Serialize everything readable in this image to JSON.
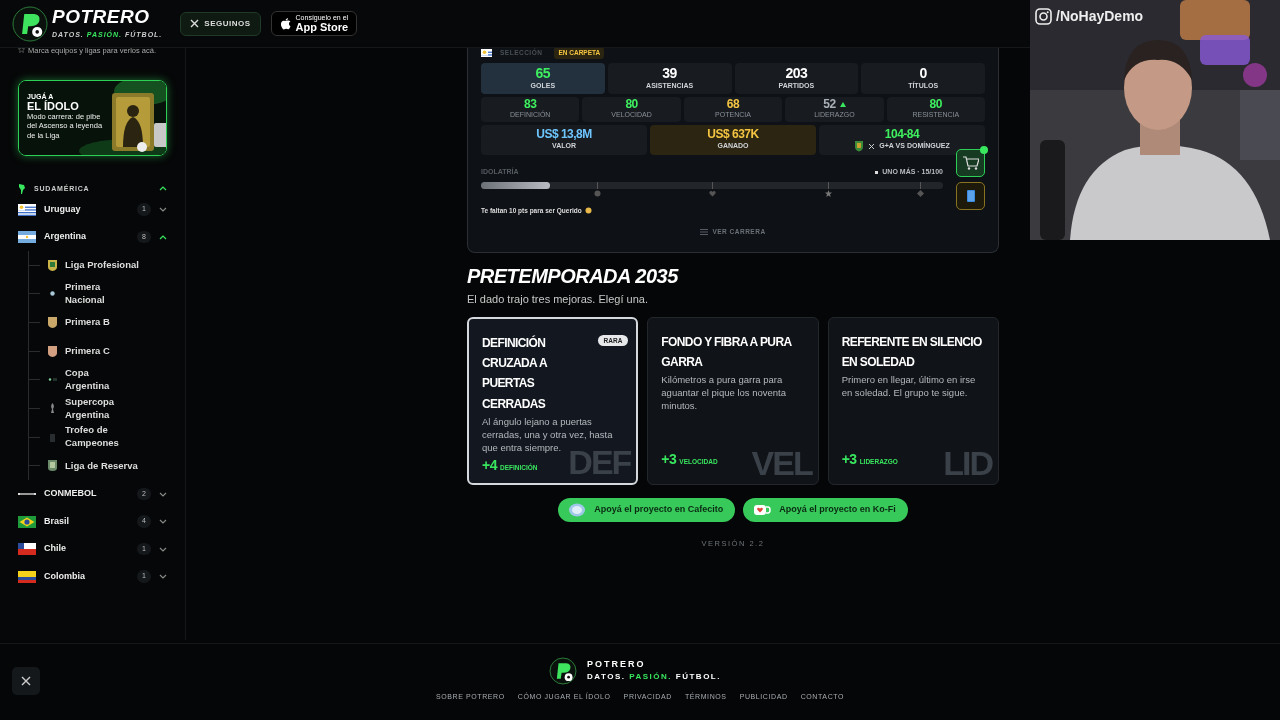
{
  "header": {
    "brand": "POTRERO",
    "tagline": [
      {
        "text": "DATOS.",
        "accent": false
      },
      {
        "text": "PASIÓN.",
        "accent": true
      },
      {
        "text": "FÚTBOL.",
        "accent": false
      }
    ],
    "follow_button": "SEGUINOS",
    "store_button": {
      "caption": "Consíguelo en el",
      "label": "App Store"
    }
  },
  "sidebar": {
    "hint": "Marca equipos y ligas para verlos acá.",
    "promo": {
      "kicker": "JUGÁ A",
      "title": "EL ÍDOLO",
      "text": "Modo carrera: de pibe del Ascenso a leyenda de la Liga"
    },
    "region": {
      "label": "SUDAMÉRICA",
      "expanded": true
    },
    "items": [
      {
        "name": "Uruguay",
        "count": "1",
        "expanded": false
      },
      {
        "name": "Argentina",
        "count": "8",
        "expanded": true,
        "children": [
          {
            "name": "Liga Profesional"
          },
          {
            "name": "Primera Nacional"
          },
          {
            "name": "Primera B"
          },
          {
            "name": "Primera C"
          },
          {
            "name": "Copa Argentina"
          },
          {
            "name": "Supercopa Argentina"
          },
          {
            "name": "Trofeo de Campeones"
          },
          {
            "name": "Liga de Reserva"
          }
        ]
      },
      {
        "name": "CONMEBOL",
        "count": "2",
        "expanded": false
      },
      {
        "name": "Brasil",
        "count": "4",
        "expanded": false
      },
      {
        "name": "Chile",
        "count": "1",
        "expanded": false
      },
      {
        "name": "Colombia",
        "count": "1",
        "expanded": false
      }
    ]
  },
  "career_card": {
    "team_label": "SELECCIÓN",
    "tag": "EN CARPETA",
    "totals": [
      {
        "value": "65",
        "label": "GOLES",
        "highlight": true,
        "color": "#3ef05f"
      },
      {
        "value": "39",
        "label": "ASISTENCIAS",
        "highlight": false,
        "color": "#ffffff"
      },
      {
        "value": "203",
        "label": "PARTIDOS",
        "highlight": false,
        "color": "#ffffff"
      },
      {
        "value": "0",
        "label": "TÍTULOS",
        "highlight": false,
        "color": "#ffffff"
      }
    ],
    "attributes": [
      {
        "value": "83",
        "label": "DEFINICIÓN",
        "color": "#3ef05f",
        "rising": false
      },
      {
        "value": "80",
        "label": "VELOCIDAD",
        "color": "#3ef05f",
        "rising": false
      },
      {
        "value": "68",
        "label": "POTENCIA",
        "color": "#f5c542",
        "rising": false
      },
      {
        "value": "52",
        "label": "LIDERAZGO",
        "color": "#aab0b8",
        "rising": true
      },
      {
        "value": "80",
        "label": "RESISTENCIA",
        "color": "#3ef05f",
        "rising": false
      }
    ],
    "finances": [
      {
        "kind": "money",
        "value": "US$ 13,8M",
        "label": "VALOR",
        "color": "#6ec6ff",
        "highlight": false
      },
      {
        "kind": "money",
        "value": "US$ 637K",
        "label": "GANADO",
        "color": "#f5c542",
        "highlight": true
      },
      {
        "kind": "versus",
        "value": "104-84",
        "label": "G+A VS DOMÍNGUEZ",
        "color": "#3ef05f",
        "highlight": false
      }
    ],
    "idolatry": {
      "label": "IDOLATRÍA",
      "status": "UNO MÁS · 15/100",
      "level": 0.15,
      "hint": "Te faltan 10 pts para ser Querido"
    },
    "career_button": "VER CARRERA",
    "side_buttons": [
      {
        "kind": "shop",
        "notification": true
      },
      {
        "kind": "kit",
        "notification": false
      }
    ]
  },
  "preseason": {
    "title": "PRETEMPORADA 2035",
    "subtitle": "El dado trajo tres mejoras. Elegí una.",
    "options": [
      {
        "title": "DEFINICIÓN CRUZADA A PUERTAS CERRADAS",
        "badge": "RARA",
        "description": "Al ángulo lejano a puertas cerradas, una y otra vez, hasta que entra siempre.",
        "bonus": "+4",
        "stat": "DEFINICIÓN",
        "watermark": "DEF",
        "selected": true
      },
      {
        "title": "FONDO Y FIBRA A PURA GARRA",
        "description": "Kilómetros a pura garra para aguantar el pique los noventa minutos.",
        "bonus": "+3",
        "stat": "VELOCIDAD",
        "watermark": "VEL",
        "selected": false
      },
      {
        "title": "REFERENTE EN SILENCIO EN SOLEDAD",
        "description": "Primero en llegar, último en irse en soledad. El grupo te sigue.",
        "bonus": "+3",
        "stat": "LIDERAZGO",
        "watermark": "LID",
        "selected": false
      }
    ]
  },
  "support_buttons": [
    {
      "kind": "cafecito",
      "label": "Apoyá el proyecto en Cafecito"
    },
    {
      "kind": "kofi",
      "label": "Apoyá el proyecto en Ko-Fi"
    }
  ],
  "version": "VERSIÓN 2.2",
  "footer": {
    "brand": "POTRERO",
    "tagline": [
      {
        "text": "DATOS.",
        "accent": false
      },
      {
        "text": "PASIÓN.",
        "accent": true
      },
      {
        "text": "FÚTBOL.",
        "accent": false
      }
    ],
    "links": [
      "SOBRE POTRERO",
      "CÓMO JUGAR EL ÍDOLO",
      "PRIVACIDAD",
      "TÉRMINOS",
      "PUBLICIDAD",
      "CONTACTO"
    ]
  },
  "stream_overlay": {
    "handle": "/NoHayDemo"
  }
}
